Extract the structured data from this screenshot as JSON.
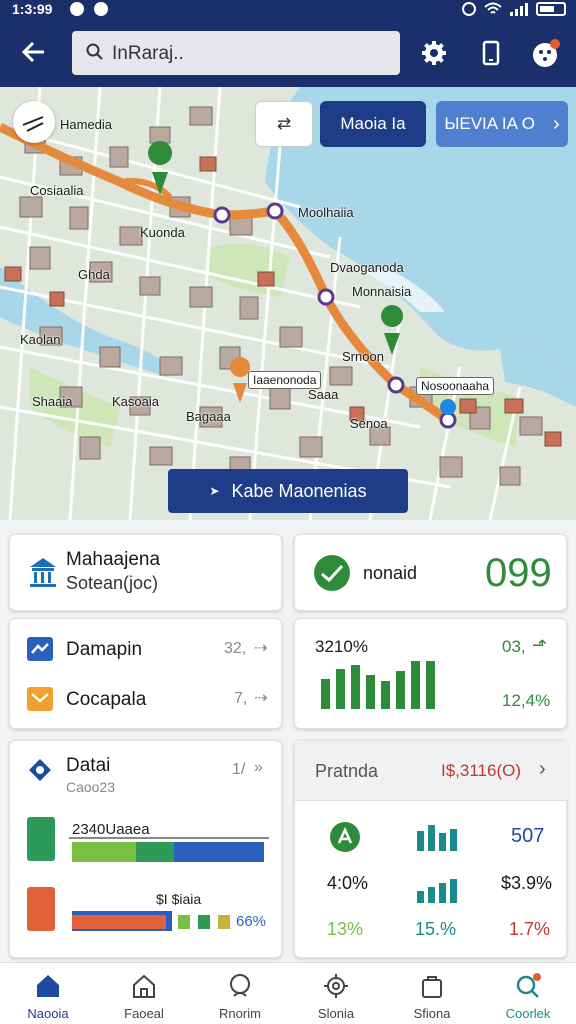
{
  "status": {
    "time": "1:3:99"
  },
  "search": {
    "text": "InRaraj.."
  },
  "map": {
    "labels": [
      "Hamedia",
      "Cosiaalia",
      "Kuonda",
      "Moolhaiia",
      "Dvaoganoda",
      "Monnaisia",
      "Kaolan",
      "Srnoon",
      "Shaaia",
      "Kasoaia",
      "Bagaaa",
      "Iaaenonoda",
      "Nosoonaaha",
      "Saaa",
      "Senoa",
      "Ghda"
    ],
    "swap_label": "⇄",
    "route_label": "Maoia Ia",
    "next_label": "ЫЕVIA ΙΑ Ο",
    "next_chev": "›",
    "start_route": "Kabe Maonenias",
    "start_arrow": "➤"
  },
  "cards": {
    "place": {
      "title": "Mahaajena",
      "sub": "Sotean(joc)"
    },
    "score": {
      "label": "nonaid",
      "value": "099"
    },
    "list": [
      {
        "label": "Damapin",
        "value": "32,",
        "arrow": "⇢"
      },
      {
        "label": "Cocapala",
        "value": "7,",
        "arrow": "⇢"
      }
    ],
    "stats": {
      "label": "3210%",
      "v1": "03,",
      "v2": "12,4%",
      "arrow": "⬏"
    },
    "data": {
      "title": "Datai",
      "sub": "Caoo23",
      "count": "1/",
      "bar1_label": "2340Uaaea",
      "bar2_label": "$I $iaia",
      "bar2_pct": "66%"
    },
    "pratnda": {
      "title": "Pratnda",
      "value": "I$,3116(O)",
      "chev": "›",
      "row1_val": "507",
      "row2_left": "4:0%",
      "row2_right": "$3.9%",
      "row3_left": "13%",
      "row3_mid": "15.%",
      "row3_right": "1.7%"
    }
  },
  "nav": [
    {
      "label": "Naooia"
    },
    {
      "label": "Faoeal"
    },
    {
      "label": "Rnorim"
    },
    {
      "label": "Slonia"
    },
    {
      "label": "Sfiona"
    },
    {
      "label": "Coorlek"
    }
  ],
  "colors": {
    "primary": "#1f3c88",
    "accent": "#4f80cf",
    "green": "#2e8b3a",
    "route": "#e58a3c"
  }
}
